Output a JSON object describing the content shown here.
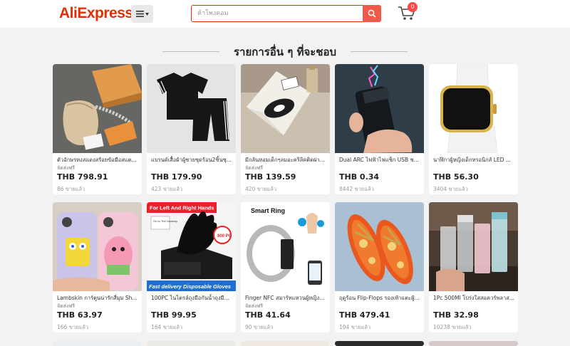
{
  "header": {
    "logo": "AliExpress",
    "search_placeholder": "ค้าโพงคอม",
    "cart_count": "0"
  },
  "section": {
    "title": "รายการอื่น ๆ ที่จะชอบ"
  },
  "products": [
    {
      "name": "ตัวอักษรหงสแดงสร้อยข้อมือสแต...",
      "shipping": "จัดส่งฟรี",
      "price": "THB 798.91",
      "sold": "86 ขายแล้ว",
      "image": "watch-bracelet-box"
    },
    {
      "name": "แบรนด์เสื้อผ้าผู้ชายชุดร้อน2ชิ้นชุ...",
      "shipping": "",
      "price": "THB 179.90",
      "sold": "423 ขายแล้ว",
      "image": "black-tracksuit"
    },
    {
      "name": "มีกล้นหอมเด็กๆลมอะคริลิคติดผ่า...",
      "shipping": "จัดส่งฟรี",
      "price": "THB 139.59",
      "sold": "420 ขายแล้ว",
      "image": "car-air-freshener"
    },
    {
      "name": "Dual ARC ไฟฟ้าไฟแช็ก USB ชา...",
      "shipping": "",
      "price": "THB 0.34",
      "sold": "8442 ขายแล้ว",
      "image": "arc-lighter"
    },
    {
      "name": "นาฬิกาผู้หญิงเด็กทรอนิกส์ LED ...",
      "shipping": "",
      "price": "THB 56.30",
      "sold": "3404 ขายแล้ว",
      "image": "white-led-watch"
    },
    {
      "name": "Lambskin การ์ตูนน่ารักสี่มุม Sha...",
      "shipping": "จัดส่งฟรี",
      "price": "THB 63.97",
      "sold": "166 ขายแล้ว",
      "image": "cartoon-phone-case"
    },
    {
      "name": "100PC ไนไตรล์ถุงมือกันน้ำถุงมือ...",
      "shipping": "",
      "price": "THB 99.95",
      "sold": "164 ขายแล้ว",
      "image": "nitrile-gloves"
    },
    {
      "name": "Finger NFC สมาร์ทแหวนผู้หญิง...",
      "shipping": "จัดส่งฟรี",
      "price": "THB 41.64",
      "sold": "90 ขายแล้ว",
      "image": "smart-ring"
    },
    {
      "name": "ฤดูร้อน Flip-Flops รองเท้าแตะผู้...",
      "shipping": "",
      "price": "THB 479.41",
      "sold": "104 ขายแล้ว",
      "image": "flip-flops"
    },
    {
      "name": "1Pc 500Ml โปร่งใสสแควร์พลาส...",
      "shipping": "",
      "price": "THB 32.98",
      "sold": "10238 ขายแล้ว",
      "image": "water-bottles"
    }
  ],
  "image_texts": {
    "gloves_banner": "For Left And Right Hands",
    "gloves_bottom": "Fast delivery Disposable Gloves",
    "gloves_count": "800 PC",
    "gloves_sign": "Go to The Lavatory",
    "ring_label": "Smart Ring"
  },
  "colors": {
    "brand": "#e62e04",
    "search_button": "#f15a4a",
    "badge": "#ff4747"
  }
}
